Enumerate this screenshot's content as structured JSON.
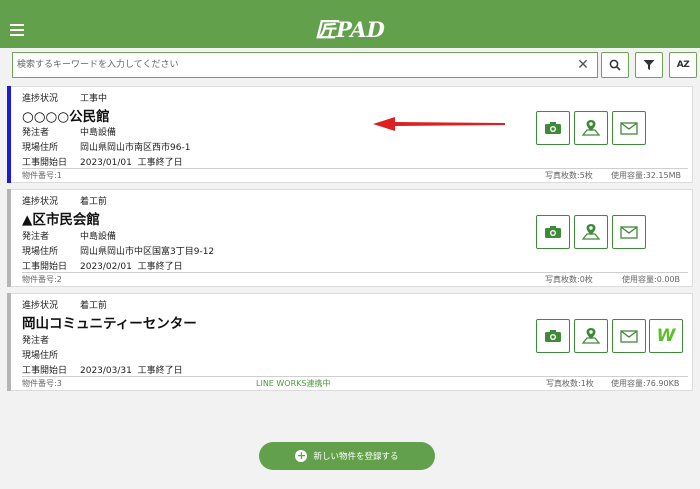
{
  "app": {
    "title": "匠PAD"
  },
  "search": {
    "placeholder": "検索するキーワードを入力してください",
    "value": ""
  },
  "toolbar": {
    "sort_label": "AZ"
  },
  "labels": {
    "progress": "進捗状況",
    "orderer": "発注者",
    "site_address": "現場住所",
    "start_date": "工事開始日",
    "end_date": "工事終了日",
    "property_no": "物件番号:",
    "photo_count": "写真枚数:",
    "usage": "使用容量:"
  },
  "properties": [
    {
      "status": "工事中",
      "name": "○○○○公民館",
      "orderer": "中島設備",
      "address": "岡山県岡山市南区西市96-1",
      "start": "2023/01/01",
      "end": "",
      "number": "1",
      "photos": "5枚",
      "usage": "32.15MB",
      "accent_color": "#1a1adc",
      "line_works": ""
    },
    {
      "status": "着工前",
      "name": "▲区市民会館",
      "orderer": "中島設備",
      "address": "岡山県岡山市中区国富3丁目9-12",
      "start": "2023/02/01",
      "end": "",
      "number": "2",
      "photos": "0枚",
      "usage": "0.00B",
      "accent_color": "#b5b5b5",
      "line_works": ""
    },
    {
      "status": "着工前",
      "name": "岡山コミュニティーセンター",
      "orderer": "",
      "address": "",
      "start": "2023/03/31",
      "end": "",
      "number": "3",
      "photos": "1枚",
      "usage": "76.90KB",
      "accent_color": "#b5b5b5",
      "line_works": "LINE WORKS連携中"
    }
  ],
  "actions": {
    "line_works_badge": "W"
  },
  "footer": {
    "register_label": "新しい物件を登録する"
  },
  "colors": {
    "brand": "#63a04c",
    "button_border": "#3f8a3a",
    "annotation_arrow": "#e02020"
  }
}
